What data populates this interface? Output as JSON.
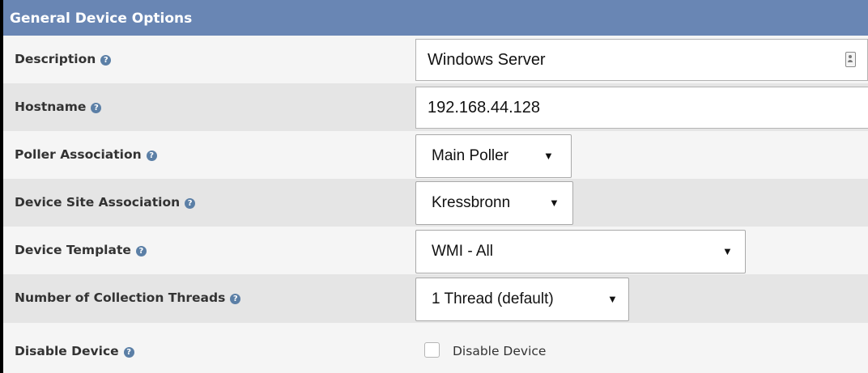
{
  "header": {
    "title": "General Device Options"
  },
  "help_glyph": "?",
  "fields": {
    "description": {
      "label": "Description",
      "value": "Windows Server"
    },
    "hostname": {
      "label": "Hostname",
      "value": "192.168.44.128"
    },
    "poller_association": {
      "label": "Poller Association",
      "selected": "Main Poller"
    },
    "device_site_association": {
      "label": "Device Site Association",
      "selected": "Kressbronn"
    },
    "device_template": {
      "label": "Device Template",
      "selected": "WMI - All"
    },
    "collection_threads": {
      "label": "Number of Collection Threads",
      "selected": "1 Thread (default)"
    },
    "disable_device": {
      "label": "Disable Device",
      "checkbox_label": "Disable Device",
      "checked": false
    }
  },
  "icons": {
    "help": "help-icon",
    "autofill": "contact-card-icon",
    "dropdown": "caret-down-icon"
  },
  "colors": {
    "header_bg": "#6986b4",
    "row_light": "#f5f5f5",
    "row_dark": "#e5e5e5",
    "help_icon": "#5b7fa6"
  }
}
